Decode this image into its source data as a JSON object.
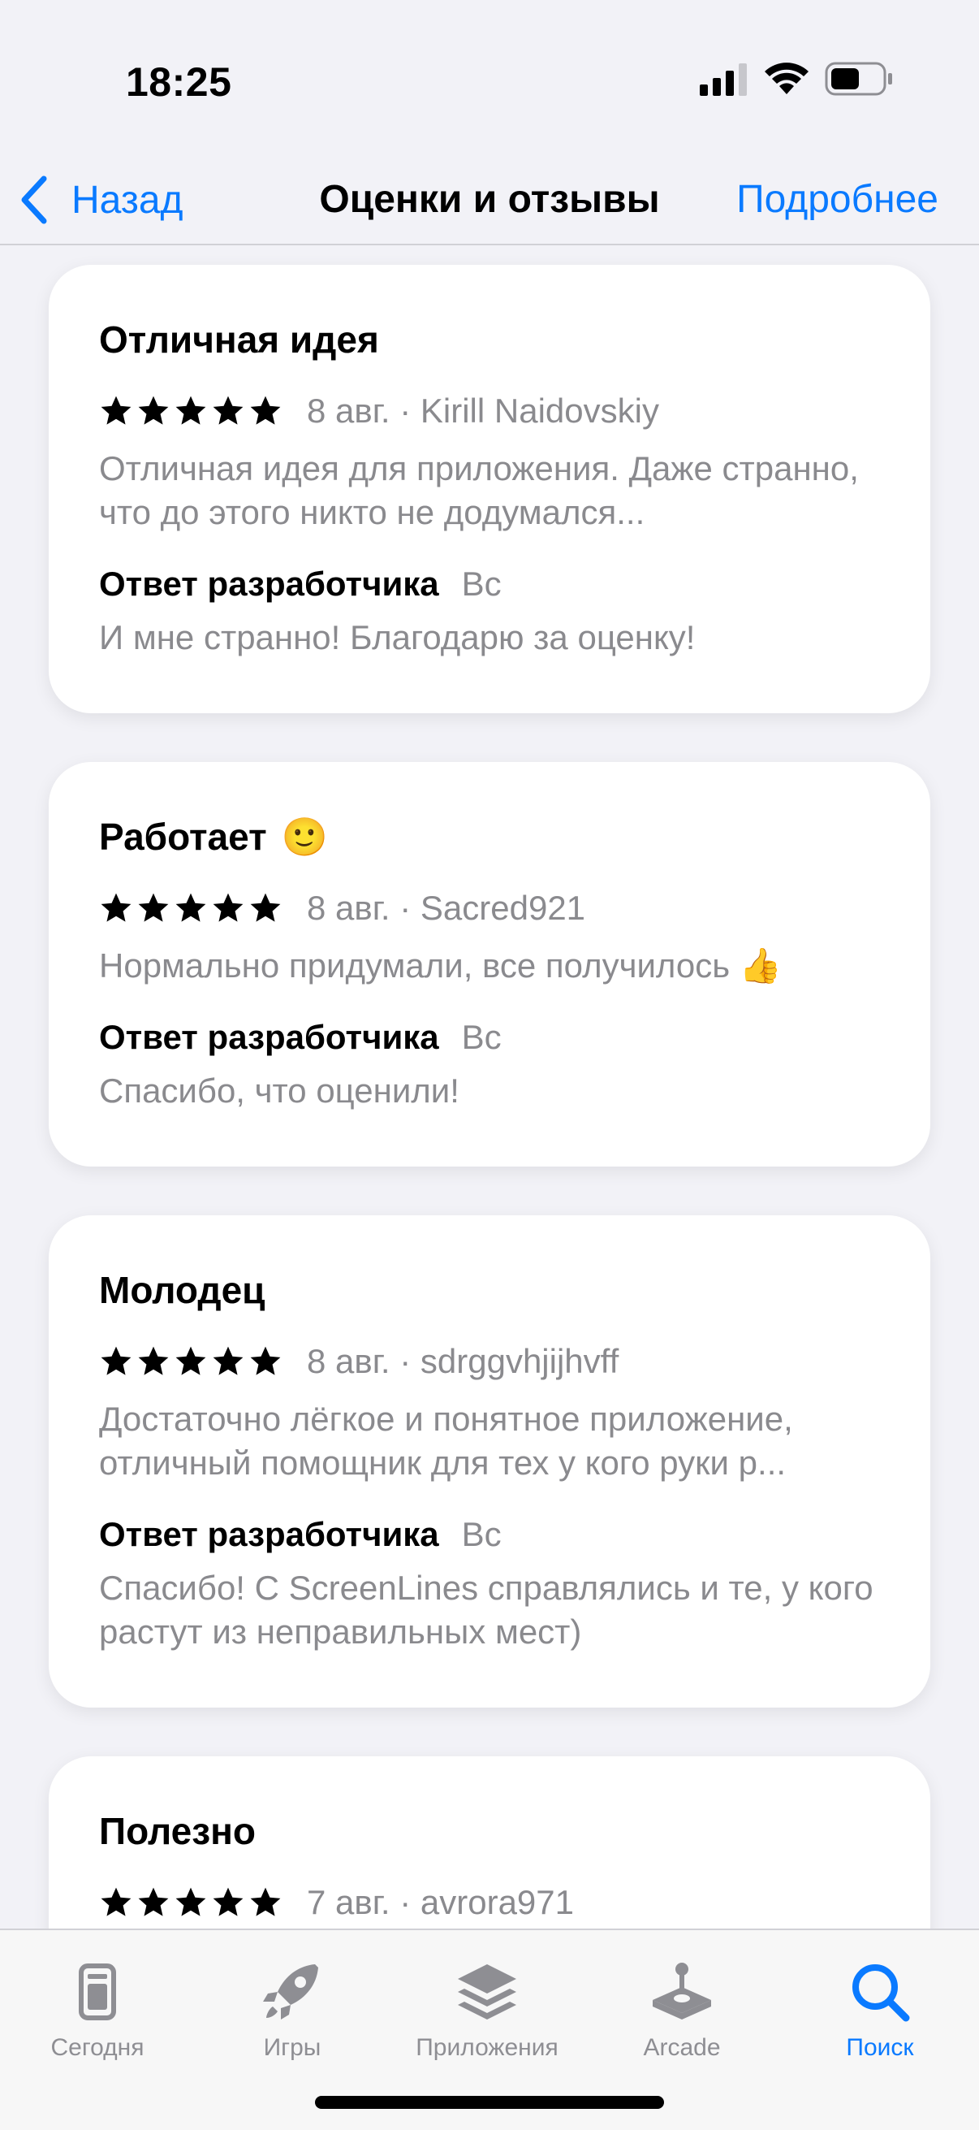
{
  "status_bar": {
    "time": "18:25"
  },
  "nav": {
    "back_label": "Назад",
    "title": "Оценки и отзывы",
    "more_label": "Подробнее"
  },
  "reviews": [
    {
      "title": "Отличная идея",
      "emoji": "",
      "rating": 5,
      "meta": "8 авг. · Kirill Naidovskiy",
      "body": "Отличная идея для приложения. Даже странно, что до этого никто не додумался...",
      "dev_label": "Ответ разработчика",
      "dev_date": "Вс",
      "dev_text": "И мне странно! Благодарю за оценку!"
    },
    {
      "title": "Работает",
      "emoji": "🙂",
      "rating": 5,
      "meta": "8 авг. · Sacred921",
      "body": "Нормально придумали, все получилось 👍",
      "dev_label": "Ответ разработчика",
      "dev_date": "Вс",
      "dev_text": "Спасибо, что оценили!"
    },
    {
      "title": "Молодец",
      "emoji": "",
      "rating": 5,
      "meta": "8 авг. · sdrggvhjijhvff",
      "body": "Достаточно лёгкое и понятное приложение, отличный помощник для тех у кого руки р...",
      "dev_label": "Ответ разработчика",
      "dev_date": "Вс",
      "dev_text": "Спасибо! С ScreenLines справлялись и те, у кого растут из неправильных мест)"
    },
    {
      "title": "Полезно",
      "emoji": "",
      "rating": 5,
      "meta": "7 авг. · avrora971"
    }
  ],
  "tabs": [
    {
      "label": "Сегодня",
      "icon": "today-icon",
      "active": false
    },
    {
      "label": "Игры",
      "icon": "games-rocket-icon",
      "active": false
    },
    {
      "label": "Приложения",
      "icon": "apps-stack-icon",
      "active": false
    },
    {
      "label": "Arcade",
      "icon": "arcade-joystick-icon",
      "active": false
    },
    {
      "label": "Поиск",
      "icon": "search-icon",
      "active": true
    }
  ],
  "colors": {
    "accent": "#0a7aff",
    "secondary_text": "#8a8a8e",
    "background": "#f2f2f7",
    "card": "#ffffff"
  }
}
